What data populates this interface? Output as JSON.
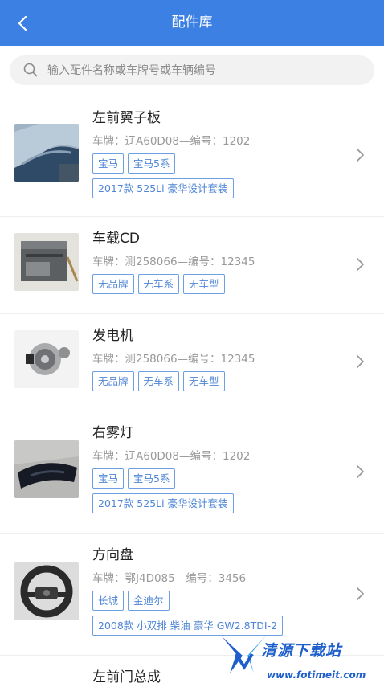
{
  "header": {
    "title": "配件库"
  },
  "search": {
    "placeholder": "输入配件名称或车牌号或车辆编号",
    "value": ""
  },
  "parts": [
    {
      "name": "左前翼子板",
      "plate_line": "车牌：辽A60D08—编号：1202",
      "tags": [
        "宝马",
        "宝马5系"
      ],
      "model_tag": "2017款 525Li 豪华设计套装",
      "image": "fender-photo"
    },
    {
      "name": "车载CD",
      "plate_line": "车牌：测258066—编号：12345",
      "tags": [
        "无品牌",
        "无车系",
        "无车型"
      ],
      "model_tag": "",
      "image": "cd-player-photo"
    },
    {
      "name": "发电机",
      "plate_line": "车牌：测258066—编号：12345",
      "tags": [
        "无品牌",
        "无车系",
        "无车型"
      ],
      "model_tag": "",
      "image": "alternator-photo"
    },
    {
      "name": "右雾灯",
      "plate_line": "车牌：辽A60D08—编号：1202",
      "tags": [
        "宝马",
        "宝马5系"
      ],
      "model_tag": "2017款 525Li 豪华设计套装",
      "image": "fog-light-photo"
    },
    {
      "name": "方向盘",
      "plate_line": "车牌：鄂J4D085—编号：3456",
      "tags": [
        "长城",
        "金迪尔"
      ],
      "model_tag": "2008款 小双排 柴油 豪华 GW2.8TDI-2",
      "image": "steering-wheel-photo"
    },
    {
      "name": "左前门总成",
      "plate_line": "",
      "tags": [],
      "model_tag": "",
      "image": ""
    }
  ],
  "icons": {
    "back": "back-arrow-icon",
    "search": "search-icon",
    "chevron": "chevron-right-icon"
  },
  "colors": {
    "header_bg": "#3d80e4",
    "tag_border": "#6d9fe3",
    "tag_text": "#4f86d6"
  },
  "watermark": {
    "title": "清源下载站",
    "url": "www.fotimeit.com"
  }
}
